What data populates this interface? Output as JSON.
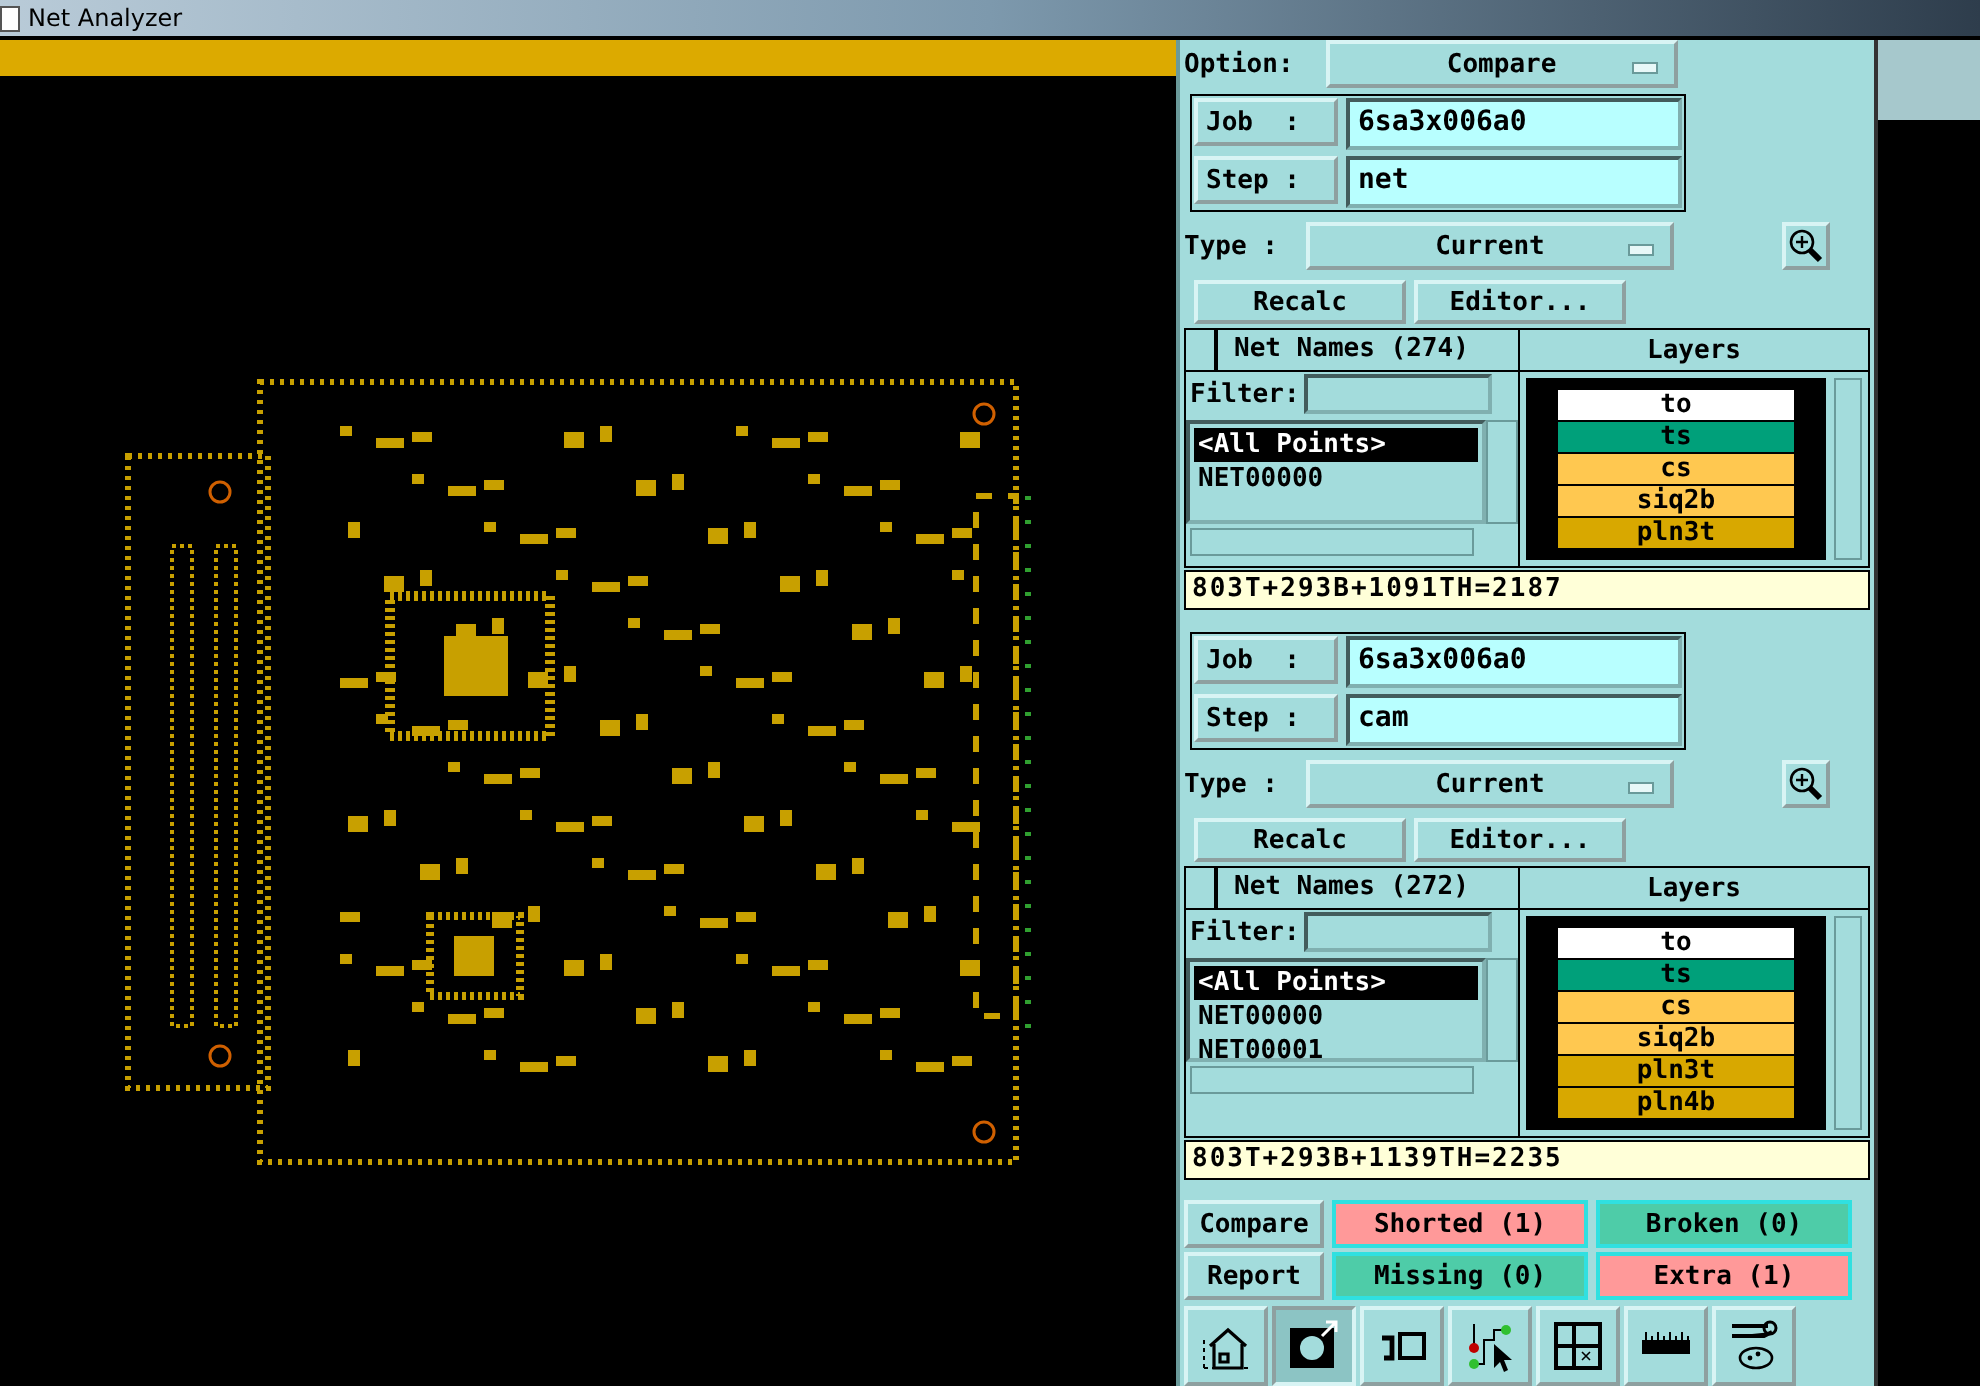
{
  "window": {
    "title": "Net Analyzer"
  },
  "option": {
    "label": "Option:",
    "value": "Compare"
  },
  "sections": [
    {
      "job_label": "Job  :",
      "job": "6sa3x006a0",
      "step_label": "Step :",
      "step": "net",
      "type_label": "Type :",
      "type": "Current",
      "buttons": [
        "Recalc",
        "Editor..."
      ],
      "net_header": "Net Names (274)",
      "layers_header": "Layers",
      "filter_label": "Filter:",
      "nets": [
        {
          "name": "<All Points>",
          "selected": true
        },
        {
          "name": "NET00000",
          "selected": false
        }
      ],
      "layers": [
        {
          "name": "to",
          "color": "#ffffff"
        },
        {
          "name": "ts",
          "color": "#00a07a"
        },
        {
          "name": "cs",
          "color": "#ffc850"
        },
        {
          "name": "siq2b",
          "color": "#ffc850"
        },
        {
          "name": "pln3t",
          "color": "#d8a800"
        }
      ],
      "summary": "803T+293B+1091TH=2187"
    },
    {
      "job_label": "Job  :",
      "job": "6sa3x006a0",
      "step_label": "Step :",
      "step": "cam",
      "type_label": "Type :",
      "type": "Current",
      "buttons": [
        "Recalc",
        "Editor..."
      ],
      "net_header": "Net Names (272)",
      "layers_header": "Layers",
      "filter_label": "Filter:",
      "nets": [
        {
          "name": "<All Points>",
          "selected": true
        },
        {
          "name": "NET00000",
          "selected": false
        },
        {
          "name": "NET00001",
          "selected": false
        }
      ],
      "layers": [
        {
          "name": "to",
          "color": "#ffffff"
        },
        {
          "name": "ts",
          "color": "#00a07a"
        },
        {
          "name": "cs",
          "color": "#ffc850"
        },
        {
          "name": "siq2b",
          "color": "#ffc850"
        },
        {
          "name": "pln3t",
          "color": "#d8a800"
        },
        {
          "name": "pln4b",
          "color": "#d8a800"
        }
      ],
      "summary": "803T+293B+1139TH=2235"
    }
  ],
  "results": [
    {
      "action": "Compare",
      "items": [
        {
          "label": "Shorted (1)",
          "color": "#ff9999"
        },
        {
          "label": "Broken (0)",
          "color": "#4ecca8"
        }
      ]
    },
    {
      "action": "Report",
      "items": [
        {
          "label": "Missing (0)",
          "color": "#4ecca8"
        },
        {
          "label": "Extra (1)",
          "color": "#ff9999"
        }
      ]
    }
  ],
  "toolbar": [
    {
      "kind": "house",
      "selected": false
    },
    {
      "kind": "circle",
      "selected": true
    },
    {
      "kind": "undo",
      "selected": false
    },
    {
      "kind": "route",
      "selected": false
    },
    {
      "kind": "grid",
      "selected": false
    },
    {
      "kind": "ruler",
      "selected": false
    },
    {
      "kind": "tools",
      "selected": false
    }
  ]
}
